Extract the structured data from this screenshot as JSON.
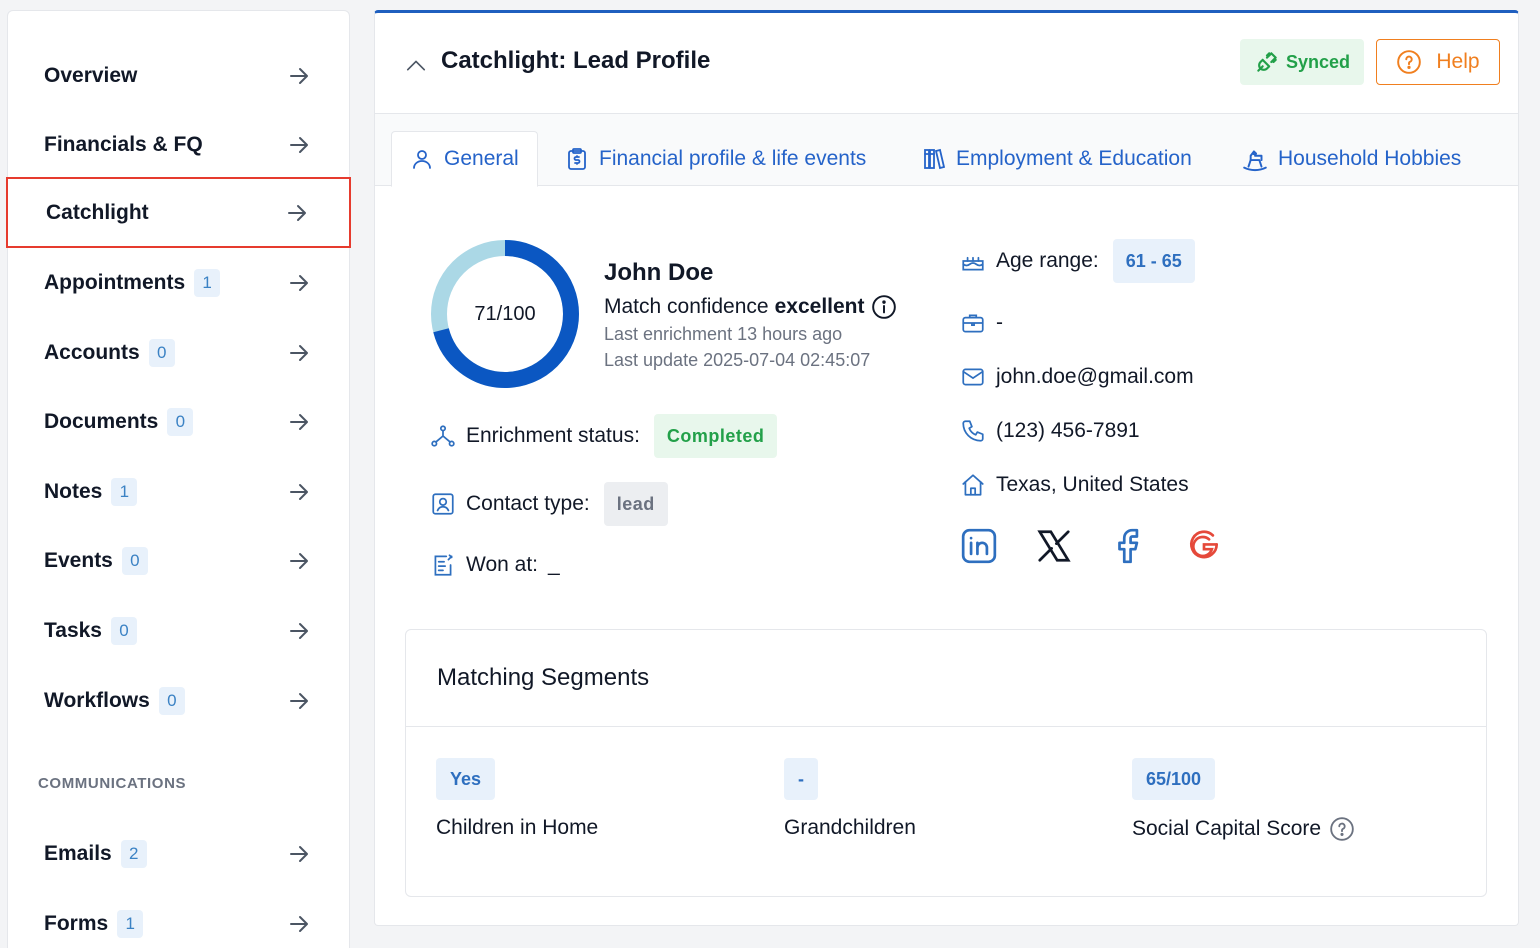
{
  "sidebar": {
    "items": [
      {
        "label": "Overview",
        "badge": null
      },
      {
        "label": "Financials & FQ",
        "badge": null
      },
      {
        "label": "Catchlight",
        "badge": null,
        "active": true
      },
      {
        "label": "Appointments",
        "badge": "1"
      },
      {
        "label": "Accounts",
        "badge": "0"
      },
      {
        "label": "Documents",
        "badge": "0"
      },
      {
        "label": "Notes",
        "badge": "1"
      },
      {
        "label": "Events",
        "badge": "0"
      },
      {
        "label": "Tasks",
        "badge": "0"
      },
      {
        "label": "Workflows",
        "badge": "0"
      }
    ],
    "section_label": "COMMUNICATIONS",
    "comm_items": [
      {
        "label": "Emails",
        "badge": "2"
      },
      {
        "label": "Forms",
        "badge": "1"
      }
    ]
  },
  "header": {
    "title": "Catchlight: Lead Profile",
    "synced_label": "Synced",
    "help_label": "Help"
  },
  "tabs": [
    {
      "label": "General",
      "icon": "user-icon",
      "active": true
    },
    {
      "label": "Financial profile & life events",
      "icon": "clipboard-dollar-icon"
    },
    {
      "label": "Employment & Education",
      "icon": "books-icon"
    },
    {
      "label": "Household Hobbies",
      "icon": "rocking-horse-icon"
    }
  ],
  "profile": {
    "score_text": "71/100",
    "score": 71,
    "score_max": 100,
    "name": "John Doe",
    "match_prefix": "Match confidence",
    "match_value": "excellent",
    "last_enrichment": "Last enrichment 13 hours ago",
    "last_update": "Last update 2025-07-04 02:45:07",
    "enrichment_label": "Enrichment status:",
    "enrichment_value": "Completed",
    "contact_type_label": "Contact type:",
    "contact_type_value": "lead",
    "won_at_label": "Won at:",
    "won_at_value": "_",
    "age_range_label": "Age range:",
    "age_range_value": "61 - 65",
    "occupation": "-",
    "email": "john.doe@gmail.com",
    "phone": "(123) 456-7891",
    "location": "Texas, United States"
  },
  "socials": [
    "linkedin-icon",
    "x-icon",
    "facebook-icon",
    "google-icon"
  ],
  "segments": {
    "title": "Matching Segments",
    "items": [
      {
        "value": "Yes",
        "label": "Children in Home"
      },
      {
        "value": "-",
        "label": "Grandchildren"
      },
      {
        "value": "65/100",
        "label": "Social Capital Score"
      }
    ]
  },
  "colors": {
    "accent_blue": "#2563c9",
    "donut_dark": "#0b57c2",
    "donut_light": "#abd8e6",
    "success": "#22a049",
    "warning": "#f07f1f",
    "active_border": "#e63b2e"
  }
}
